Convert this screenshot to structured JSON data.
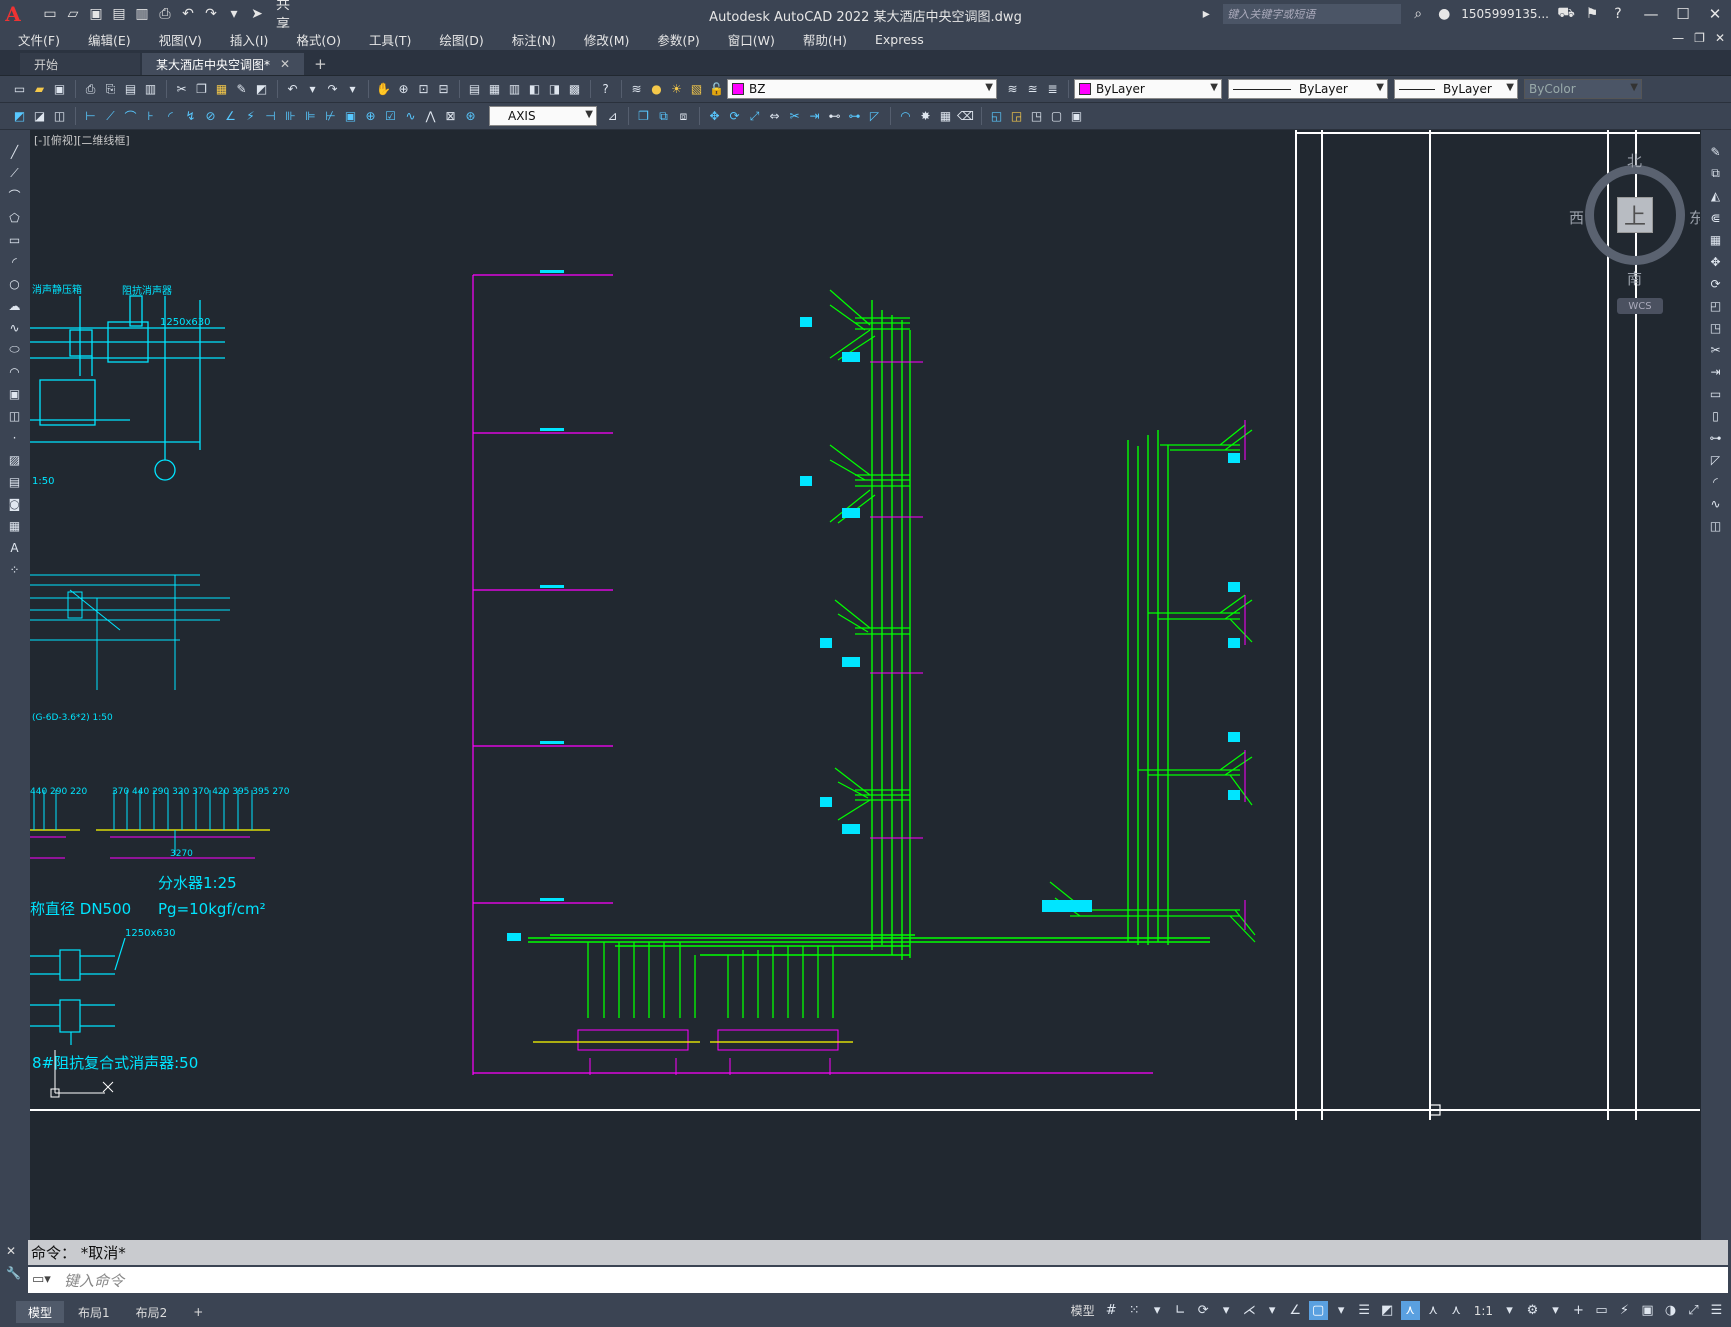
{
  "app": {
    "title": "Autodesk AutoCAD 2022    某大酒店中央空调图.dwg",
    "logo": "A",
    "share_label": "共享",
    "search_placeholder": "键入关键字或短语",
    "user": "1505999135..."
  },
  "menu": [
    "文件(F)",
    "编辑(E)",
    "视图(V)",
    "插入(I)",
    "格式(O)",
    "工具(T)",
    "绘图(D)",
    "标注(N)",
    "修改(M)",
    "参数(P)",
    "窗口(W)",
    "帮助(H)",
    "Express"
  ],
  "tabs": [
    {
      "label": "开始",
      "active": false
    },
    {
      "label": "某大酒店中央空调图*",
      "active": true
    }
  ],
  "toolbar1": {
    "layer_name": "BZ",
    "layer_color": "#ff00ff",
    "color_value": "ByLayer",
    "linetype_value": "ByLayer",
    "lineweight_value": "ByLayer",
    "plotstyle_value": "ByColor"
  },
  "toolbar2": {
    "dimstyle_value": "AXIS"
  },
  "canvas": {
    "view_label": "[-][俯视][二维线框]",
    "texts": {
      "silencer_box_label": "消声静压箱",
      "impedance_silencer": "阻抗消声器",
      "duct_size_1": "1250x630",
      "scale_150": "1:50",
      "section_label": "(G-6D-3.6*2) 1:50",
      "dims_left": "440 290 220",
      "dims_right": "370 440 290 320 370 420 395 395 270",
      "total_len": "3270",
      "distributor": "分水器1:25",
      "nominal_dn": "称直径 DN500",
      "pressure": "Pg=10kgf/cm²",
      "duct_size_2": "1250x630",
      "silencer_8": "8#阻抗复合式消声器:50"
    }
  },
  "viewcube": {
    "north": "北",
    "south": "南",
    "east": "东",
    "west": "西",
    "face": "上",
    "wcs": "WCS"
  },
  "command": {
    "history": "命令：  *取消*",
    "placeholder": "键入命令"
  },
  "layouts": [
    {
      "label": "模型",
      "active": true
    },
    {
      "label": "布局1",
      "active": false
    },
    {
      "label": "布局2",
      "active": false
    }
  ],
  "status": {
    "model_label": "模型",
    "scale": "1:1"
  },
  "colors": {
    "pipe_green": "#00ff00",
    "cyan": "#00e5ff",
    "magenta": "#ff00ff",
    "yellow": "#ffff00",
    "white": "#ffffff"
  }
}
